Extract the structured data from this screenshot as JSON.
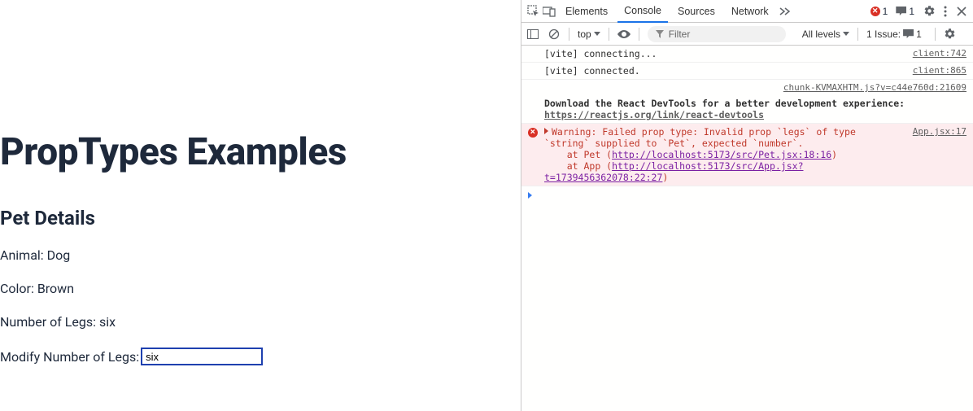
{
  "page": {
    "title": "PropTypes Examples",
    "section": "Pet Details",
    "animal": "Animal: Dog",
    "color": "Color: Brown",
    "legs": "Number of Legs: six",
    "modify_label": "Modify Number of Legs:",
    "input_value": "six"
  },
  "devtools": {
    "tabs": {
      "elements": "Elements",
      "console": "Console",
      "sources": "Sources",
      "network": "Network"
    },
    "badges": {
      "errors": "1",
      "messages": "1"
    },
    "toolbar": {
      "context": "top",
      "filter_placeholder": "Filter",
      "levels": "All levels",
      "issues_label": "1 Issue:",
      "issues_count": "1"
    },
    "logs": {
      "l1_msg": "[vite] connecting...",
      "l1_src": "client:742",
      "l2_msg": "[vite] connected.",
      "l2_src": "client:865",
      "l3_src": "chunk-KVMAXHTM.js?v=c44e760d:21609",
      "l4_msg_a": "Download the React DevTools for a better development experience: ",
      "l4_link": "https://reactjs.org/link/react-devtools",
      "err_src": "App.jsx:17",
      "err_line1": "Warning: Failed prop type: Invalid prop `legs` of type `string` supplied to `Pet`, expected `number`.",
      "err_line2a": "    at Pet (",
      "err_link2": "http://localhost:5173/src/Pet.jsx:18:16",
      "err_line2b": ")",
      "err_line3a": "    at App (",
      "err_link3": "http://localhost:5173/src/App.jsx?t=1739456362078:22:27",
      "err_line3b": ")"
    }
  }
}
